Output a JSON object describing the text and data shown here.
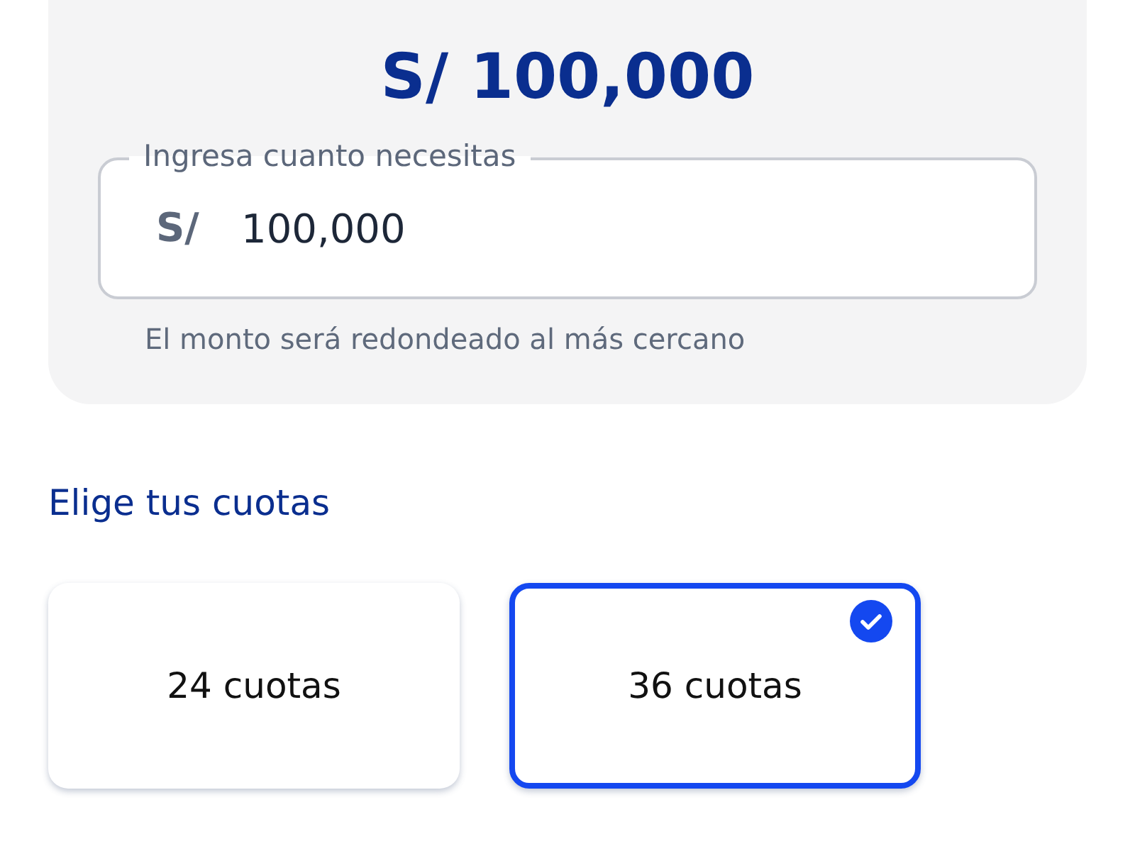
{
  "amount_card": {
    "amount": "S/ 100,000",
    "field": {
      "label": "Ingresa cuanto necesitas",
      "prefix": "S/",
      "value": "100,000"
    },
    "hint": "El monto será redondeado al más cercano"
  },
  "installments": {
    "title": "Elige tus cuotas",
    "options": [
      {
        "label": "24 cuotas",
        "selected": false
      },
      {
        "label": "36 cuotas",
        "selected": true
      }
    ]
  }
}
